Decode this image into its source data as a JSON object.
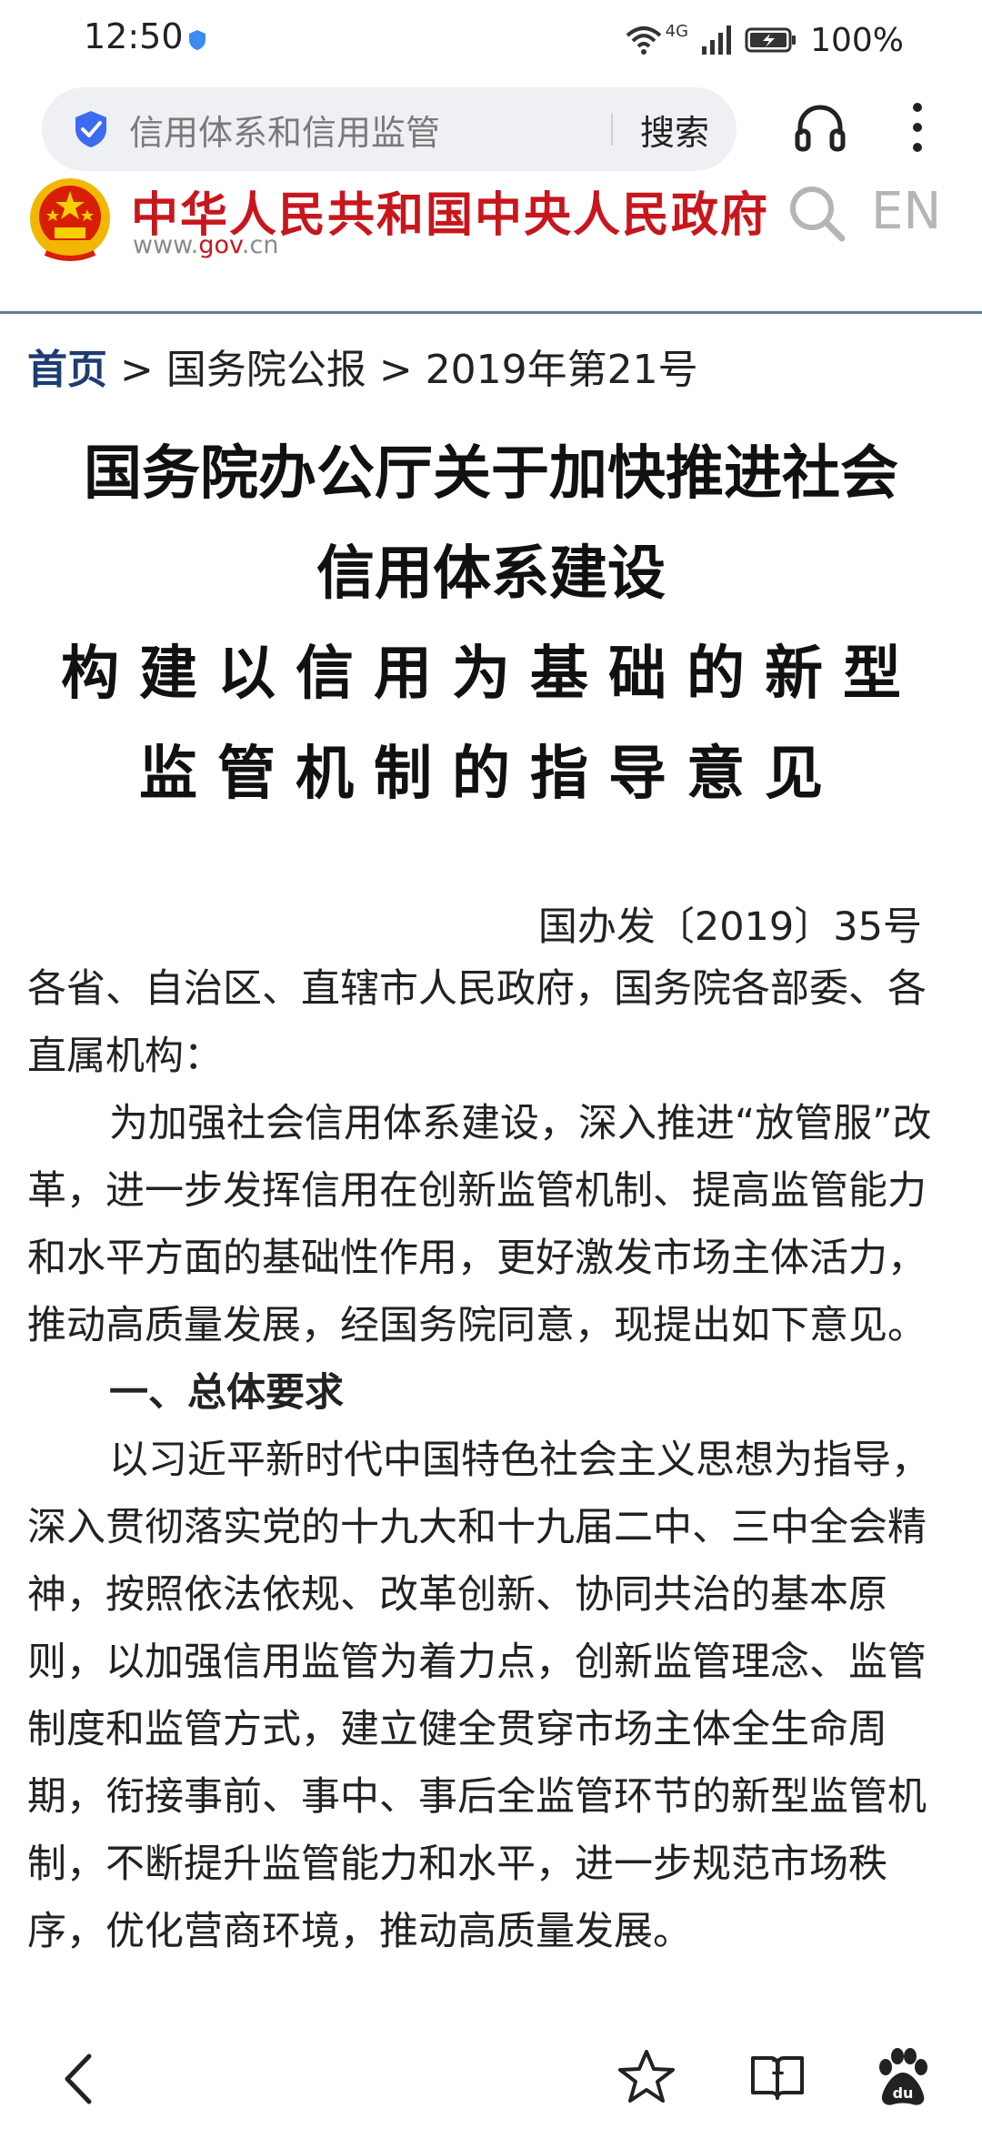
{
  "status_bar": {
    "time": "12:50",
    "network": "4G",
    "battery": "100%"
  },
  "search_bar": {
    "query": "信用体系和信用监管",
    "search_label": "搜索"
  },
  "site": {
    "name": "中华人民共和国中央人民政府",
    "url_prefix": "www.",
    "url_brand": "gov",
    "url_suffix": ".cn",
    "lang_link": "EN"
  },
  "breadcrumb": {
    "home": "首页",
    "sep1": " > ",
    "item1": "国务院公报",
    "sep2": " > ",
    "item2": "2019年第21号"
  },
  "article": {
    "title_lines": [
      "国务院办公厅关于加快推进社会",
      "信用体系建设",
      "构建以信用为基础的新型",
      "监管机制的指导意见"
    ],
    "doc_number": "国办发〔2019〕35号",
    "addressee": "各省、自治区、直辖市人民政府，国务院各部委、各直属机构：",
    "para1": "为加强社会信用体系建设，深入推进“放管服”改革，进一步发挥信用在创新监管机制、提高监管能力和水平方面的基础性作用，更好激发市场主体活力，推动高质量发展，经国务院同意，现提出如下意见。",
    "section1_heading": "一、总体要求",
    "para2": "以习近平新时代中国特色社会主义思想为指导，深入贯彻落实党的十九大和十九届二中、三中全会精神，按照依法依规、改革创新、协同共治的基本原则，以加强信用监管为着力点，创新监管理念、监管制度和监管方式，建立健全贯穿市场主体全生命周期，衔接事前、事中、事后全监管环节的新型监管机制，不断提升监管能力和水平，进一步规范市场秩序，优化营商环境，推动高质量发展。"
  },
  "bottom_nav": {
    "tab_count": "1"
  },
  "colors": {
    "brand_red": "#c8161d",
    "breadcrumb_blue": "#1d3d73",
    "shield_blue": "#3d6bf0",
    "header_rule": "#5f7d9a"
  }
}
